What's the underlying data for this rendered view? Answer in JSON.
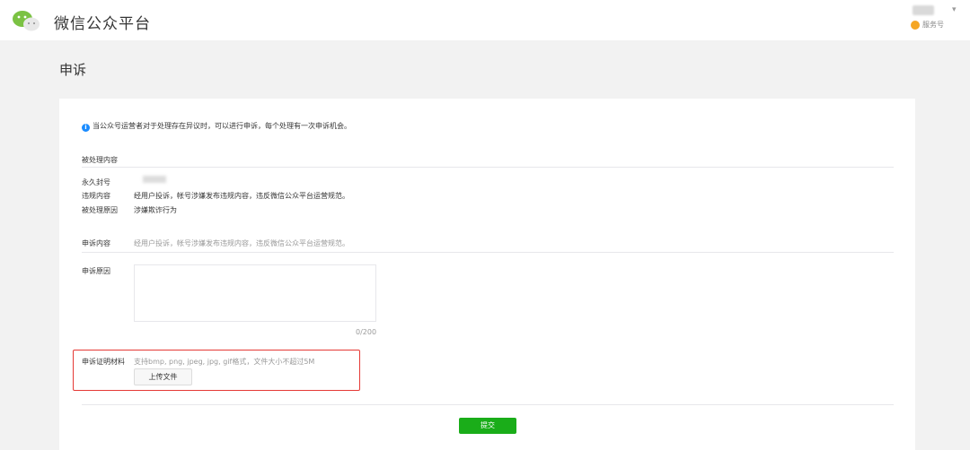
{
  "header": {
    "brand": "微信公众平台",
    "logo_icon": "wechat-logo-icon",
    "account_type": "服务号",
    "account_type_color": "#f5a623"
  },
  "page": {
    "title": "申诉"
  },
  "notice": {
    "icon": "info-icon",
    "icon_glyph": "i",
    "text": "当公众号运营者对于处理存在异议时，可以进行申诉，每个处理有一次申诉机会。"
  },
  "handled": {
    "section_title": "被处理内容",
    "rows": [
      {
        "label": "永久封号",
        "value": ""
      },
      {
        "label": "违规内容",
        "value": "经用户投诉，帐号涉嫌发布违规内容，违反微信公众平台运营规范。"
      },
      {
        "label": "被处理原因",
        "value": "涉嫌欺诈行为"
      }
    ]
  },
  "appeal": {
    "content_label": "申诉内容",
    "content_value": "经用户投诉，帐号涉嫌发布违规内容，违反微信公众平台运营规范。",
    "reason_label": "申诉原因",
    "reason_value": "",
    "counter": "0/200",
    "material_label": "申诉证明材料",
    "material_hint": "支持bmp, png, jpeg, jpg, gif格式，文件大小不超过5M",
    "upload_label": "上传文件",
    "highlight_color": "#e53935"
  },
  "actions": {
    "submit_label": "提交",
    "submit_color": "#1aad19"
  }
}
